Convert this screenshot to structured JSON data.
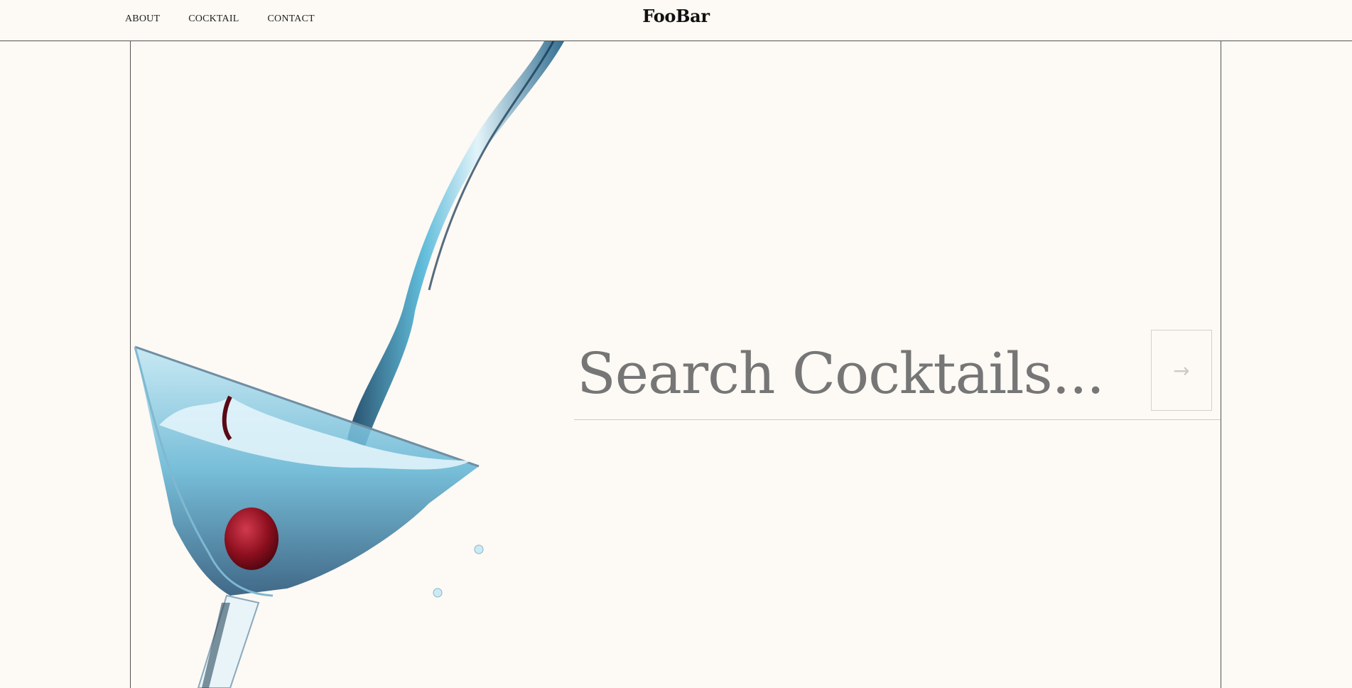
{
  "nav": {
    "items": [
      {
        "label": "ABOUT"
      },
      {
        "label": "COCKTAIL"
      },
      {
        "label": "CONTACT"
      }
    ]
  },
  "brand": {
    "name": "FooBar"
  },
  "search": {
    "placeholder": "Search Cocktails...",
    "value": ""
  },
  "submit": {
    "icon": "→"
  },
  "colors": {
    "background": "#fdf9f4",
    "text": "#111111",
    "placeholder": "#767676",
    "liquid": "#3fa3c7",
    "cherry": "#8c0f1e"
  }
}
